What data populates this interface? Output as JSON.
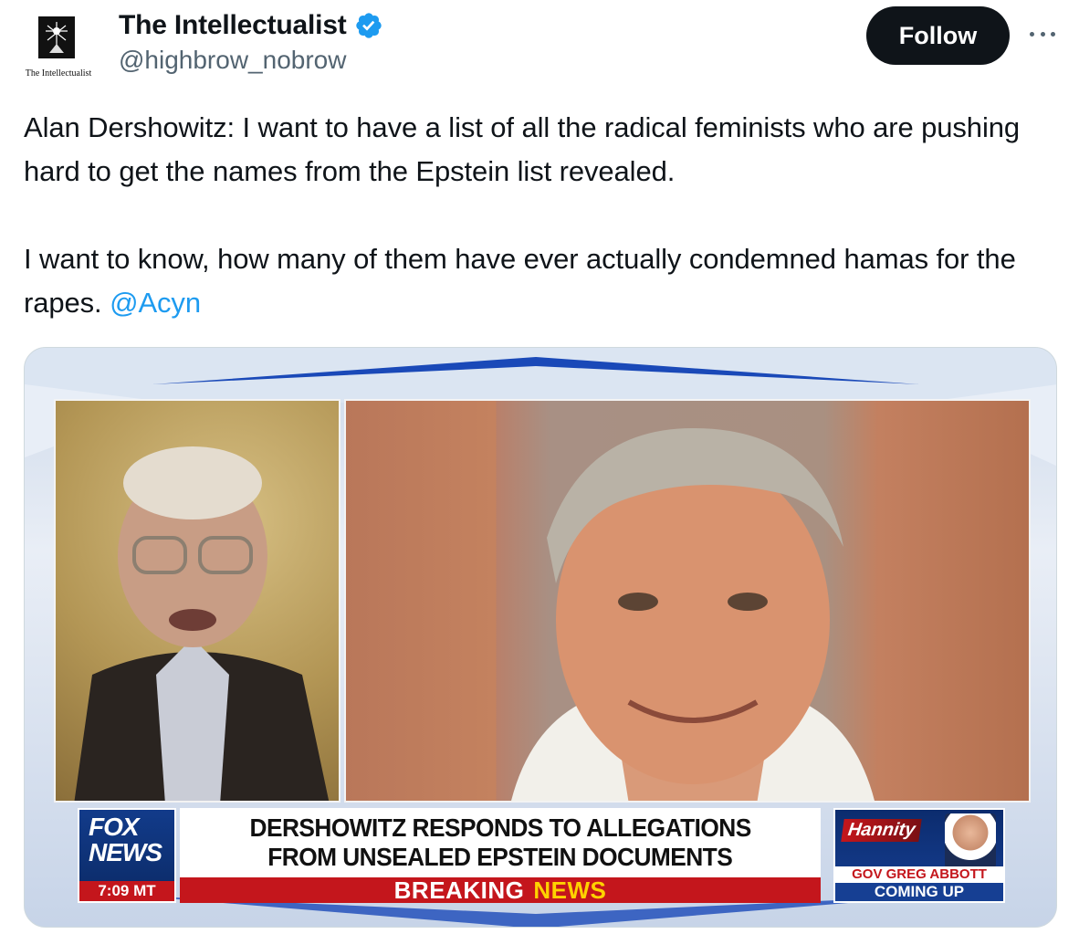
{
  "author": {
    "display_name": "The Intellectualist",
    "handle": "@highbrow_nobrow",
    "avatar_text": "The Intellectualist",
    "verified": true
  },
  "actions": {
    "follow_label": "Follow",
    "more_icon": "more-horizontal-icon"
  },
  "tweet": {
    "paragraph_1": "Alan Dershowitz: I want to have a list of all the radical feminists who are pushing hard to get the names from the Epstein list revealed.",
    "paragraph_2_text": "I want to know, how many of them have ever actually condemned hamas for the rapes.",
    "mention": "@Acyn"
  },
  "media": {
    "network_word_1": "FOX",
    "network_word_2": "NEWS",
    "timestamp": "7:09 MT",
    "headline_line_1": "DERSHOWITZ RESPONDS TO ALLEGATIONS",
    "headline_line_2": "FROM UNSEALED EPSTEIN DOCUMENTS",
    "breaking_1": "BREAKING",
    "breaking_2": "NEWS",
    "promo_show": "Hannity",
    "promo_line_1": "GOV GREG ABBOTT",
    "promo_line_2": "COMING UP"
  },
  "colors": {
    "mention_blue": "#1d9bf0",
    "verified_blue": "#1d9bf0",
    "follow_bg": "#0f1419",
    "fox_red": "#c4161c"
  }
}
